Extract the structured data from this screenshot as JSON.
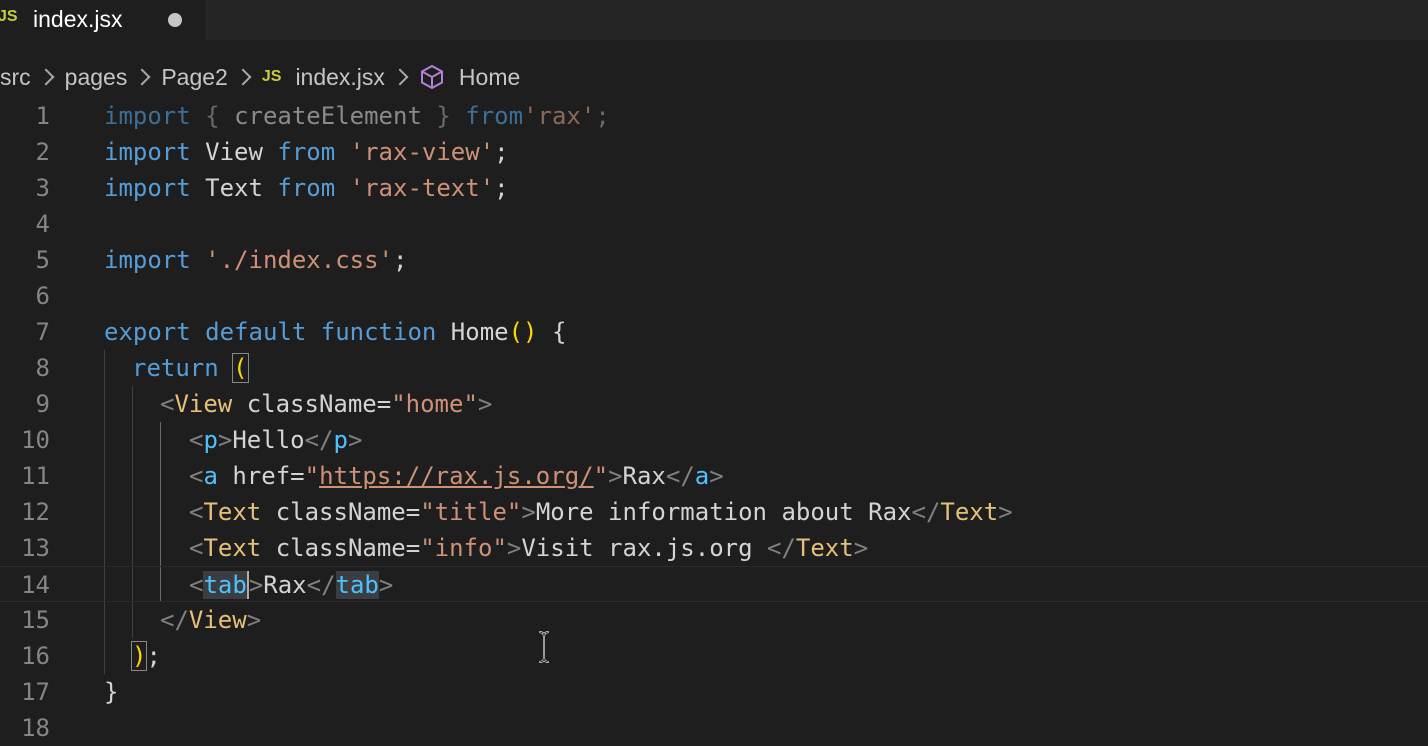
{
  "tab": {
    "badge": "JS",
    "title": "index.jsx"
  },
  "breadcrumb": {
    "items": [
      "src",
      "pages",
      "Page2",
      "index.jsx",
      "Home"
    ],
    "file_badge": "JS"
  },
  "line_numbers": [
    "1",
    "2",
    "3",
    "4",
    "5",
    "6",
    "7",
    "8",
    "9",
    "10",
    "11",
    "12",
    "13",
    "14",
    "15",
    "16",
    "17",
    "18"
  ],
  "code": {
    "l1": {
      "import": "import",
      "open": " { ",
      "name": "createElement",
      "close": " } ",
      "from": "from",
      "str": "'rax'",
      "semi": ";"
    },
    "l2": {
      "import": "import",
      "name": " View ",
      "from": "from",
      "str": " 'rax-view'",
      "semi": ";"
    },
    "l3": {
      "import": "import",
      "name": " Text ",
      "from": "from",
      "str": " 'rax-text'",
      "semi": ";"
    },
    "l5": {
      "import": "import",
      "str": " './index.css'",
      "semi": ";"
    },
    "l7": {
      "export": "export",
      "default": " default",
      "function": " function",
      "name": " Home",
      "parens": "()",
      "brace": " {"
    },
    "l8": {
      "return": "return",
      "paren": "("
    },
    "l9": {
      "lt": "<",
      "tag": "View",
      "attr": " className",
      "eq": "=",
      "str": "\"home\"",
      "gt": ">"
    },
    "l10": {
      "lt": "<",
      "tag": "p",
      "gt": ">",
      "text": "Hello",
      "lt2": "</",
      "tag2": "p",
      "gt2": ">"
    },
    "l11": {
      "lt": "<",
      "tag": "a",
      "attr": " href",
      "eq": "=",
      "q1": "\"",
      "url": "https://rax.js.org/",
      "q2": "\"",
      "gt": ">",
      "text": "Rax",
      "lt2": "</",
      "tag2": "a",
      "gt2": ">"
    },
    "l12": {
      "lt": "<",
      "tag": "Text",
      "attr": " className",
      "eq": "=",
      "str": "\"title\"",
      "gt": ">",
      "text": "More information about Rax",
      "lt2": "</",
      "tag2": "Text",
      "gt2": ">"
    },
    "l13": {
      "lt": "<",
      "tag": "Text",
      "attr": " className",
      "eq": "=",
      "str": "\"info\"",
      "gt": ">",
      "text": "Visit rax.js.org ",
      "lt2": "</",
      "tag2": "Text",
      "gt2": ">"
    },
    "l14": {
      "lt": "<",
      "tag": "tab",
      "gt": ">",
      "text": "Rax",
      "lt2": "</",
      "tag2": "tab",
      "gt2": ">"
    },
    "l15": {
      "lt": "</",
      "tag": "View",
      "gt": ">"
    },
    "l16": {
      "paren": ")",
      "semi": ";"
    },
    "l17": {
      "brace": "}"
    }
  },
  "colors": {
    "background": "#1e1e1e",
    "keyword": "#569cd6",
    "string": "#ce9178",
    "component_tag": "#e5c07b",
    "html_tag": "#4fc1ff",
    "bracket": "#ffd700"
  }
}
